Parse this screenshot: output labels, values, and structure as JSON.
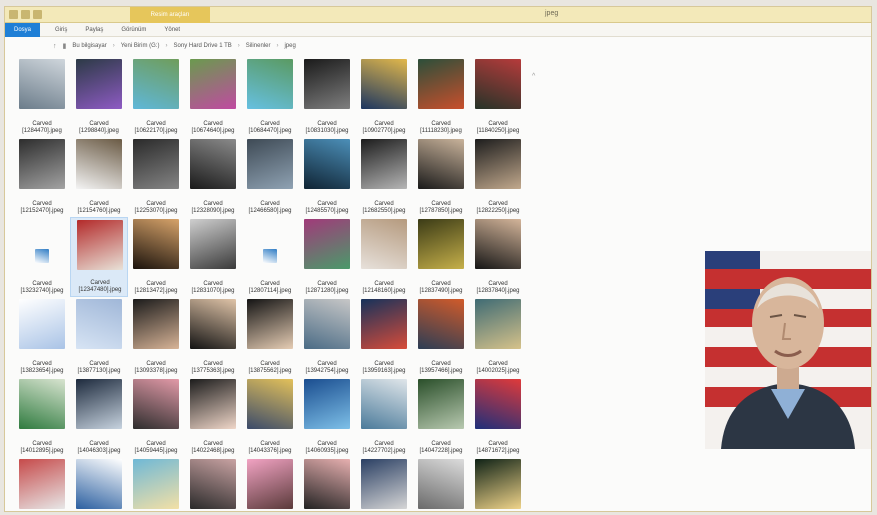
{
  "window": {
    "title": "jpeg",
    "context_tab": "Resim araçları",
    "ribbon_tabs": [
      "Dosya",
      "Giriş",
      "Paylaş",
      "Görünüm",
      "Yönet"
    ]
  },
  "address": {
    "crumbs": [
      "Bu bilgisayar",
      "Yeni Birim (G:)",
      "Sony Hard Drive 1 TB",
      "Silinenler",
      "jpeg"
    ]
  },
  "caption_line1": "Carved",
  "files": [
    {
      "name": "[1284470].jpeg",
      "colors": [
        "#6b7c8a",
        "#cfd6dc"
      ]
    },
    {
      "name": "[1298840].jpeg",
      "colors": [
        "#2c3a46",
        "#8e5bc4"
      ]
    },
    {
      "name": "[10622170].jpeg",
      "colors": [
        "#5fb7d9",
        "#6f9d5b"
      ]
    },
    {
      "name": "[10674640].jpeg",
      "colors": [
        "#6a9a4e",
        "#c04aa1"
      ]
    },
    {
      "name": "[10684470].jpeg",
      "colors": [
        "#66c0e1",
        "#5a9a62"
      ]
    },
    {
      "name": "[10831030].jpeg",
      "colors": [
        "#1a1a1a",
        "#7f7f7f"
      ]
    },
    {
      "name": "[10902770].jpeg",
      "colors": [
        "#1b3560",
        "#e2b84b"
      ]
    },
    {
      "name": "[11118230].jpeg",
      "colors": [
        "#2c4f3a",
        "#c94f2c"
      ]
    },
    {
      "name": "[11840250].jpeg",
      "colors": [
        "#253328",
        "#b63b3b"
      ]
    },
    {
      "name": "[12152470].jpeg",
      "colors": [
        "#2d2d2d",
        "#a3a3a3"
      ]
    },
    {
      "name": "[12154760].jpeg",
      "colors": [
        "#f4f4f4",
        "#6a5a44"
      ]
    },
    {
      "name": "[12253070].jpeg",
      "colors": [
        "#2a2a2a",
        "#858585"
      ]
    },
    {
      "name": "[12328090].jpeg",
      "colors": [
        "#1a1a1a",
        "#8a8a8a"
      ]
    },
    {
      "name": "[12466580].jpeg",
      "colors": [
        "#3e4a55",
        "#8fa2b3"
      ]
    },
    {
      "name": "[12485570].jpeg",
      "colors": [
        "#0f2333",
        "#4c8fb8"
      ]
    },
    {
      "name": "[12682550].jpeg",
      "colors": [
        "#1c1c1c",
        "#b6b6b6"
      ]
    },
    {
      "name": "[12787850].jpeg",
      "colors": [
        "#191919",
        "#c9b39b"
      ]
    },
    {
      "name": "[12822250].jpeg",
      "colors": [
        "#1d1d1d",
        "#c2a98d"
      ]
    },
    {
      "name": "[13232740].jpeg",
      "colors": [
        "#ffffff",
        "#2f7cc4"
      ],
      "small": true
    },
    {
      "name": "[12347480].jpeg",
      "colors": [
        "#b32a2a",
        "#e8e2d8"
      ],
      "selected": true
    },
    {
      "name": "[12813472].jpeg",
      "colors": [
        "#1a120c",
        "#d7a36a"
      ]
    },
    {
      "name": "[12831070].jpeg",
      "colors": [
        "#cfcfcf",
        "#3a3a3a"
      ]
    },
    {
      "name": "[12807114].jpeg",
      "colors": [
        "#ffffff",
        "#2f7cc4"
      ],
      "small": true
    },
    {
      "name": "[12871280].jpeg",
      "colors": [
        "#a13a7a",
        "#4a9a6a"
      ]
    },
    {
      "name": "[12148160].jpeg",
      "colors": [
        "#e7e1db",
        "#b59a7e"
      ]
    },
    {
      "name": "[12837490].jpeg",
      "colors": [
        "#3b3b16",
        "#c6b04a"
      ]
    },
    {
      "name": "[12837840].jpeg",
      "colors": [
        "#151515",
        "#d4b59a"
      ]
    },
    {
      "name": "[13823654].jpeg",
      "colors": [
        "#ffffff",
        "#a9c3e6"
      ]
    },
    {
      "name": "[13877130].jpeg",
      "colors": [
        "#d7e4f4",
        "#a0b7d8"
      ]
    },
    {
      "name": "[13093378].jpeg",
      "colors": [
        "#1b1b1b",
        "#d8b497"
      ]
    },
    {
      "name": "[13775363].jpeg",
      "colors": [
        "#121212",
        "#e0c4a8"
      ]
    },
    {
      "name": "[13875562].jpeg",
      "colors": [
        "#141414",
        "#e6cdb4"
      ]
    },
    {
      "name": "[13942754].jpeg",
      "colors": [
        "#4a6b85",
        "#c7c7c7"
      ]
    },
    {
      "name": "[13959163].jpeg",
      "colors": [
        "#16325b",
        "#d84c3a"
      ]
    },
    {
      "name": "[13957466].jpeg",
      "colors": [
        "#2b3d55",
        "#d15b2a"
      ]
    },
    {
      "name": "[14002025].jpeg",
      "colors": [
        "#3f6b74",
        "#d6c28a"
      ]
    },
    {
      "name": "[14012895].jpeg",
      "colors": [
        "#2f7b3f",
        "#d8e4d0"
      ]
    },
    {
      "name": "[14046303].jpeg",
      "colors": [
        "#1d2a3d",
        "#c7d3df"
      ]
    },
    {
      "name": "[14059445].jpeg",
      "colors": [
        "#2d2d2d",
        "#e29aa8"
      ]
    },
    {
      "name": "[14022468].jpeg",
      "colors": [
        "#1c1c1c",
        "#f0d7c9"
      ]
    },
    {
      "name": "[14043376].jpeg",
      "colors": [
        "#3a4a6a",
        "#e3c15a"
      ]
    },
    {
      "name": "[14060935].jpeg",
      "colors": [
        "#1a4d8f",
        "#7ec0e8"
      ]
    },
    {
      "name": "[14227702].jpeg",
      "colors": [
        "#4a7a9a",
        "#e0e6ea"
      ]
    },
    {
      "name": "[14047228].jpeg",
      "colors": [
        "#2a4f2a",
        "#b8c9b0"
      ]
    },
    {
      "name": "[14871672].jpeg",
      "colors": [
        "#1e2f7a",
        "#e03a3a"
      ]
    },
    {
      "name": "",
      "colors": [
        "#c64a4a",
        "#e7e7e7"
      ]
    },
    {
      "name": "",
      "colors": [
        "#2b5fa0",
        "#ffffff"
      ]
    },
    {
      "name": "",
      "colors": [
        "#6fb8d6",
        "#f3e0a6"
      ]
    },
    {
      "name": "",
      "colors": [
        "#2a2a2a",
        "#c9a3a3"
      ]
    },
    {
      "name": "",
      "colors": [
        "#f2a3c3",
        "#5a3a3a"
      ]
    },
    {
      "name": "",
      "colors": [
        "#222222",
        "#e7b0b0"
      ]
    },
    {
      "name": "",
      "colors": [
        "#2a3f63",
        "#d6d6d6"
      ]
    },
    {
      "name": "",
      "colors": [
        "#6a6a6a",
        "#dcdcdc"
      ]
    },
    {
      "name": "",
      "colors": [
        "#0f2216",
        "#f0d48a"
      ]
    }
  ],
  "preview": {
    "alt": "Preview of selected image",
    "colors": {
      "flag_red": "#c53030",
      "flag_white": "#f4f1ee",
      "flag_blue": "#2a3f7a",
      "skin": "#d8b69b",
      "jacket": "#2c3644",
      "shirt": "#8fb0d6"
    }
  }
}
